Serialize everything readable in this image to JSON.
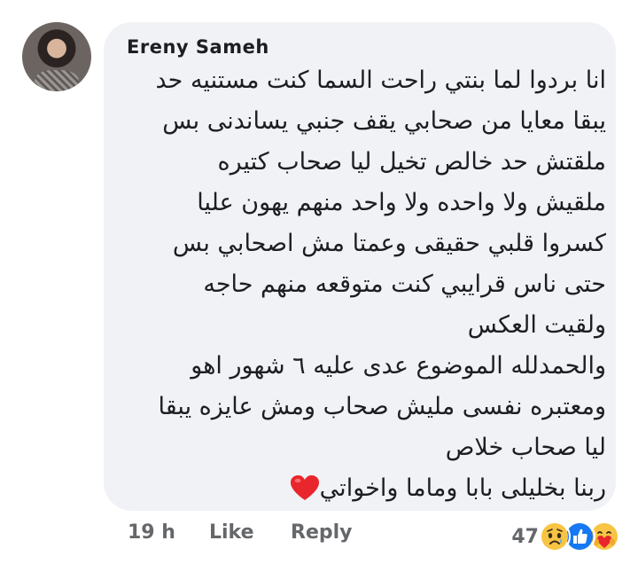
{
  "comment": {
    "author": "Ereny Sameh",
    "lines": [
      "انا بردوا لما بنتي راحت السما كنت مستنيه حد",
      "يبقا معايا من صحابي يقف جنبي يساندنى بس",
      "ملقتش حد خالص تخيل ليا صحاب كتيره",
      "ملقيش ولا واحده ولا واحد منهم يهون عليا",
      "كسروا قلبي حقيقى وعمتا مش اصحابي بس",
      "حتى ناس قرايبي كنت متوقعه منهم حاجه",
      "ولقيت العكس",
      "والحمدلله الموضوع عدى عليه ٦ شهور اهو",
      "ومعتبره نفسى مليش صحاب ومش عايزه يبقا",
      "ليا صحاب خلاص",
      "ربنا بخليلى بابا وماما واخواتي"
    ],
    "emoji": "red-heart-icon"
  },
  "meta": {
    "time": "19 h",
    "like": "Like",
    "reply": "Reply"
  },
  "reactions": {
    "count": "47",
    "icons": [
      "sad-icon",
      "like-icon",
      "care-icon"
    ]
  },
  "colors": {
    "bubble": "#f0f2f5",
    "text": "#1c1e21",
    "meta": "#65676b",
    "heart": "#e8262b",
    "like_blue": "#1877f2",
    "emoji_yellow": "#f7c543"
  }
}
